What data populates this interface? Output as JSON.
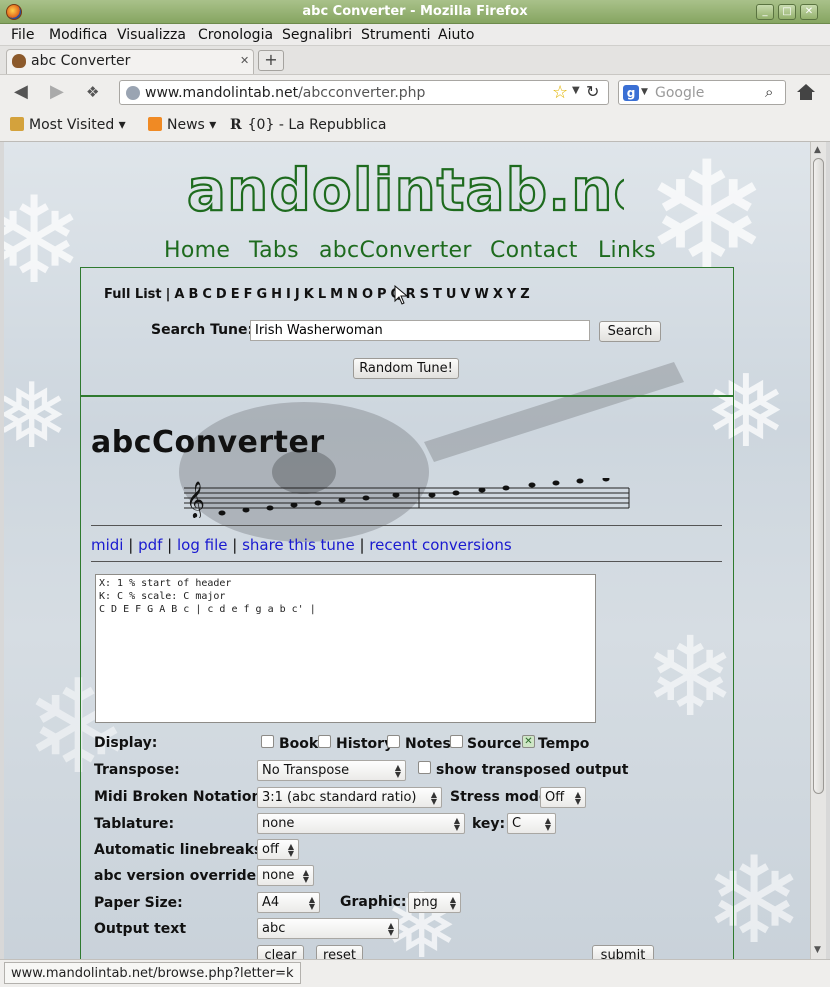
{
  "window": {
    "title": "abc Converter - Mozilla Firefox"
  },
  "menubar": {
    "items": [
      "File",
      "Modifica",
      "Visualizza",
      "Cronologia",
      "Segnalibri",
      "Strumenti",
      "Aiuto"
    ]
  },
  "tab": {
    "title": "abc Converter"
  },
  "urlbar": {
    "host": "www.mandolintab.net",
    "path": "/abcconverter.php"
  },
  "searchbar": {
    "placeholder": "Google"
  },
  "bookmarks": [
    "Most Visited",
    "News",
    "{0} - La Repubblica"
  ],
  "site": {
    "logo_text": "mandolintab.net",
    "nav": [
      "Home",
      "Tabs",
      "abcConverter",
      "Contact",
      "Links"
    ],
    "full_list": "Full List",
    "letters": [
      "A",
      "B",
      "C",
      "D",
      "E",
      "F",
      "G",
      "H",
      "I",
      "J",
      "K",
      "L",
      "M",
      "N",
      "O",
      "P",
      "Q",
      "R",
      "S",
      "T",
      "U",
      "V",
      "W",
      "X",
      "Y",
      "Z"
    ],
    "search_label": "Search Tune:",
    "search_value": "Irish Washerwoman",
    "search_button": "Search",
    "random_button": "Random Tune!"
  },
  "converter": {
    "heading": "abcConverter",
    "links": [
      "midi",
      "pdf",
      "log file",
      "share this tune",
      "recent conversions"
    ],
    "abc_text": "X: 1 % start of header\nK: C % scale: C major\nC D E F G A B c | c d e f g a b c' |",
    "display_label": "Display:",
    "display_options": [
      {
        "label": "Book",
        "checked": false
      },
      {
        "label": "History",
        "checked": false
      },
      {
        "label": "Notes",
        "checked": false
      },
      {
        "label": "Source",
        "checked": false
      },
      {
        "label": "Tempo",
        "checked": true
      }
    ],
    "transpose_label": "Transpose:",
    "transpose_value": "No Transpose",
    "show_transposed_label": "show transposed output",
    "midi_label": "Midi Broken Notation:",
    "midi_value": "3:1 (abc standard ratio)",
    "stress_label": "Stress mode:",
    "stress_value": "Off",
    "tablature_label": "Tablature:",
    "tablature_value": "none",
    "key_label": "key:",
    "key_value": "C",
    "linebreaks_label": "Automatic linebreaks",
    "linebreaks_value": "off",
    "version_label": "abc version override",
    "version_value": "none",
    "paper_label": "Paper Size:",
    "paper_value": "A4",
    "graphic_label": "Graphic:",
    "graphic_value": "png",
    "output_label": "Output text",
    "output_value": "abc",
    "clear_button": "clear",
    "reset_button": "reset",
    "submit_button": "submit"
  },
  "status": {
    "text": "www.mandolintab.net/browse.php?letter=k"
  },
  "colors": {
    "brand_green": "#1e6b1e",
    "link_blue": "#1a1ad0",
    "titlebar": "#9bb577"
  }
}
